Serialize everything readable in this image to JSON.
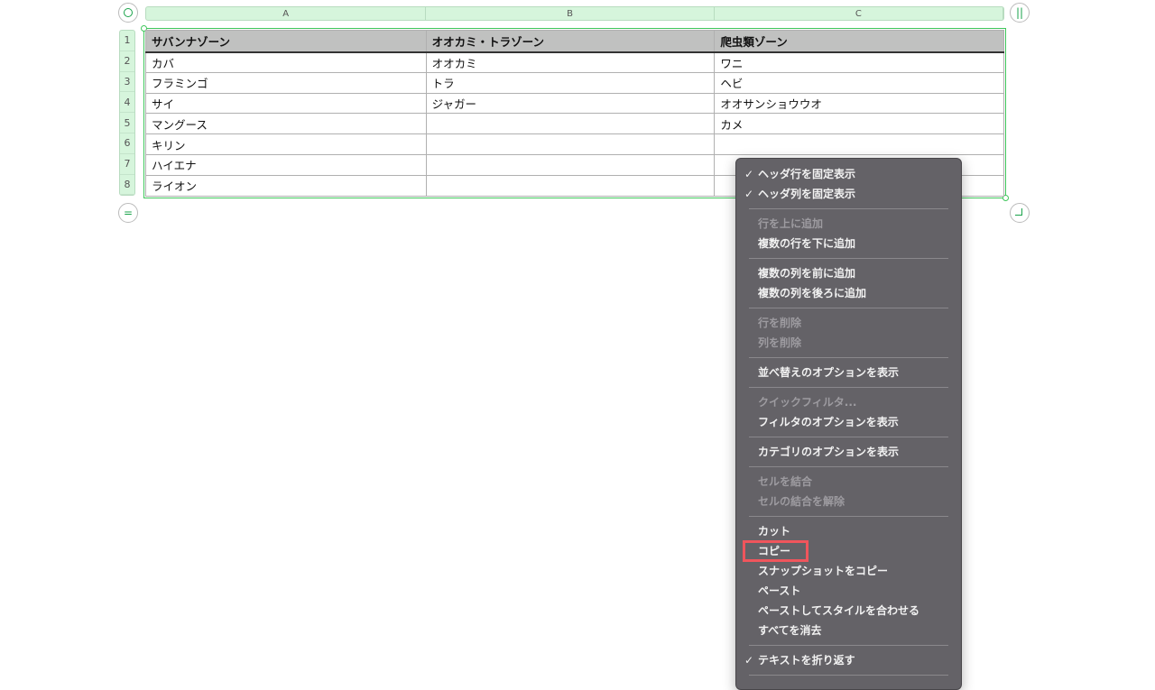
{
  "columns": [
    "A",
    "B",
    "C"
  ],
  "row_numbers": [
    "1",
    "2",
    "3",
    "4",
    "5",
    "6",
    "7",
    "8"
  ],
  "table": {
    "header": [
      "サバンナゾーン",
      "オオカミ・トラゾーン",
      "爬虫類ゾーン"
    ],
    "rows": [
      [
        "カバ",
        "オオカミ",
        "ワニ"
      ],
      [
        "フラミンゴ",
        "トラ",
        "ヘビ"
      ],
      [
        "サイ",
        "ジャガー",
        "オオサンショウウオ"
      ],
      [
        "マングース",
        "",
        "カメ"
      ],
      [
        "キリン",
        "",
        ""
      ],
      [
        "ハイエナ",
        "",
        ""
      ],
      [
        "ライオン",
        "",
        ""
      ]
    ]
  },
  "menu": {
    "groups": [
      [
        {
          "label": "ヘッダ行を固定表示",
          "checked": true
        },
        {
          "label": "ヘッダ列を固定表示",
          "checked": true
        }
      ],
      [
        {
          "label": "行を上に追加",
          "disabled": true
        },
        {
          "label": "複数の行を下に追加"
        }
      ],
      [
        {
          "label": "複数の列を前に追加"
        },
        {
          "label": "複数の列を後ろに追加"
        }
      ],
      [
        {
          "label": "行を削除",
          "disabled": true
        },
        {
          "label": "列を削除",
          "disabled": true
        }
      ],
      [
        {
          "label": "並べ替えのオプションを表示"
        }
      ],
      [
        {
          "label": "クイックフィルタ...",
          "disabled": true
        },
        {
          "label": "フィルタのオプションを表示"
        }
      ],
      [
        {
          "label": "カテゴリのオプションを表示"
        }
      ],
      [
        {
          "label": "セルを結合",
          "disabled": true
        },
        {
          "label": "セルの結合を解除",
          "disabled": true
        }
      ],
      [
        {
          "label": "カット"
        },
        {
          "label": "コピー",
          "highlighted": true
        },
        {
          "label": "スナップショットをコピー"
        },
        {
          "label": "ペースト"
        },
        {
          "label": "ペーストしてスタイルを合わせる"
        },
        {
          "label": "すべてを消去"
        }
      ],
      [
        {
          "label": "テキストを折り返す",
          "checked": true
        }
      ]
    ],
    "check_glyph": "✓"
  },
  "colors": {
    "selection": "#3ec65a",
    "highlight": "#f0555c",
    "menu_bg": "#646267"
  }
}
